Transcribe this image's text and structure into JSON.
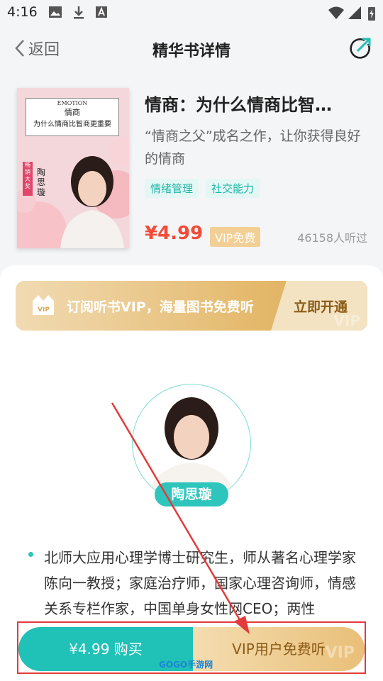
{
  "status_bar": {
    "time": "4:16"
  },
  "header": {
    "back_label": "返回",
    "title": "精华书详情"
  },
  "book": {
    "cover": {
      "en_title": "EMOTION",
      "cn_title_1": "情商",
      "cn_title_2": "为什么情商比智商更重要",
      "ribbon": "畅销大奖",
      "author_vertical": "陶思璇"
    },
    "title": "情商：为什么情商比智…",
    "description": "“情商之父”成名之作，让你获得良好的情商",
    "tags": [
      "情绪管理",
      "社交能力"
    ],
    "price": "¥4.99",
    "vip_badge": "VIP免费",
    "listeners": "46158人听过"
  },
  "vip_banner": {
    "crown_label": "VIP",
    "promo_text": "订阅听书VIP，海量图书免费听",
    "cta": "立即开通",
    "watermark": "VIP"
  },
  "author": {
    "name": "陶思璇",
    "bio": "北师大应用心理学博士研究生，师从著名心理学家陈向一教授；家庭治疗师，国家心理咨询师，情感关系专栏作家，中国单身女性网CEO；两性"
  },
  "bottom_bar": {
    "buy_label": "¥4.99 购买",
    "vip_label": "VIP用户免费听",
    "vip_watermark": "VIP"
  },
  "watermark": {
    "text": "GOGO手游网"
  },
  "colors": {
    "teal": "#20c1b7",
    "price_red": "#f24b37",
    "gold": "#e4b86a",
    "annotation_red": "#e23b3b"
  }
}
